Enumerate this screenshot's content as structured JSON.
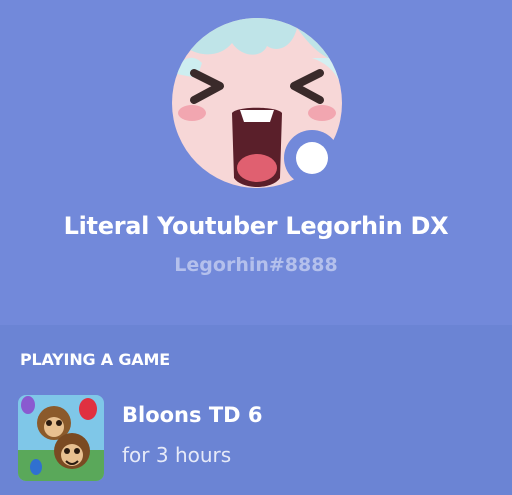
{
  "profile": {
    "display_name": "Literal Youtuber Legorhin DX",
    "tag": "Legorhin#8888",
    "avatar_icon": "anime-face-avatar",
    "status_icon": "online-status-icon"
  },
  "activity": {
    "section_title": "PLAYING A GAME",
    "game_name": "Bloons TD 6",
    "duration": "for 3 hours",
    "game_icon": "bloons-td6-icon"
  },
  "colors": {
    "header_bg": "#7289da",
    "body_bg": "#6b84d4",
    "tag_text": "#b4c0ec"
  }
}
